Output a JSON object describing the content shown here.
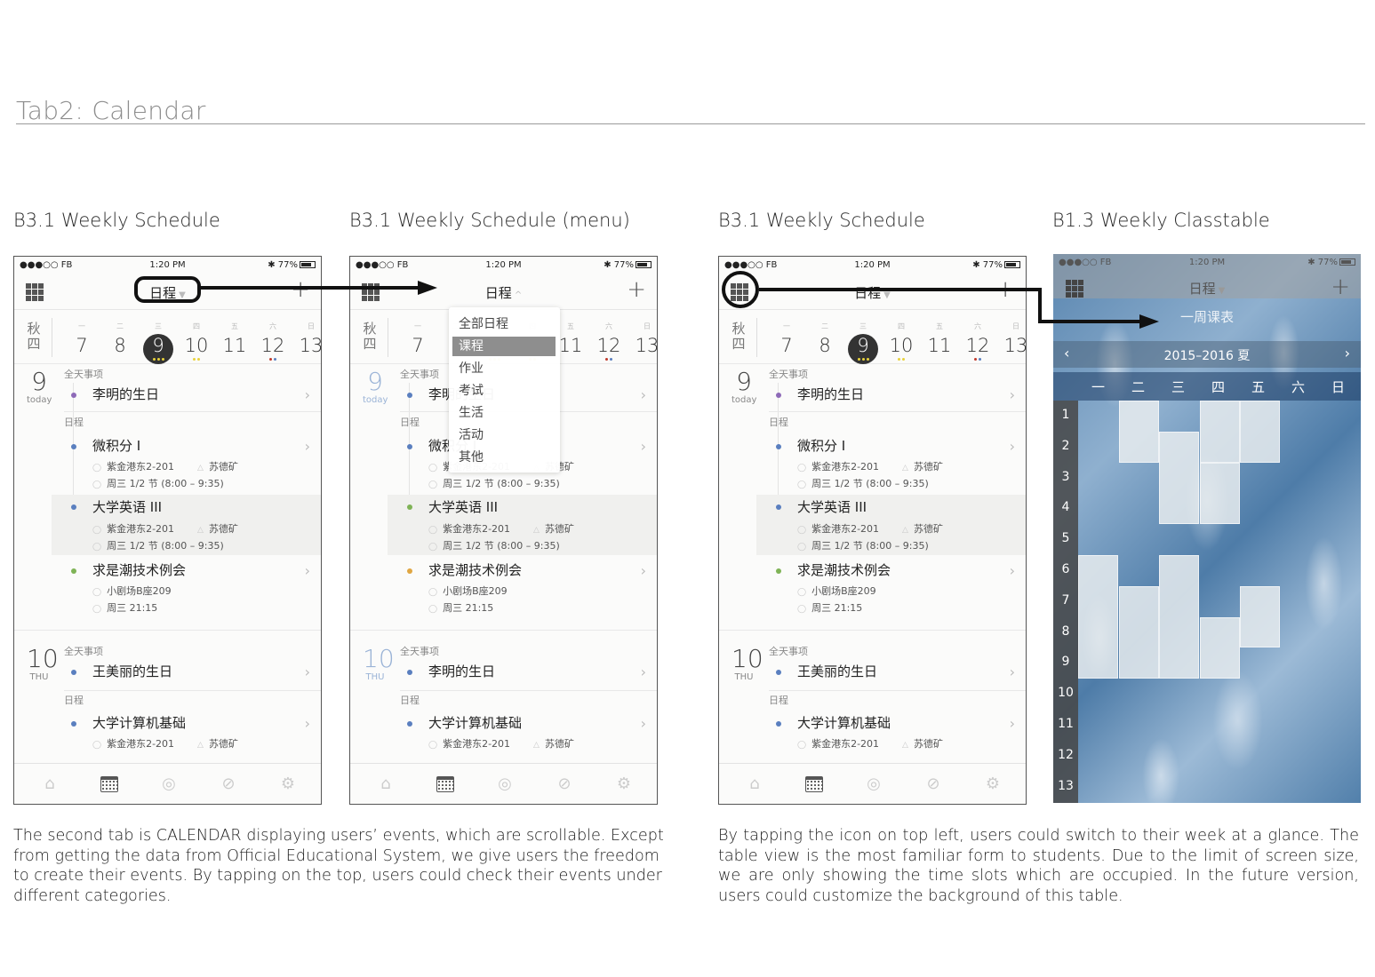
{
  "page_title": "Tab2: Calendar",
  "labels": {
    "s1": "B3.1 Weekly Schedule",
    "s2": "B3.1 Weekly Schedule (menu)",
    "s3": "B3.1 Weekly Schedule",
    "s4": "B1.3 Weekly Classtable"
  },
  "statusbar": {
    "carrier": "●●●○○ FB",
    "time": "1:20 PM",
    "battery": "77%"
  },
  "nav": {
    "title": "日程",
    "title_caret_down": "▼",
    "title_caret_up": "^",
    "add": "+"
  },
  "week": {
    "semester_top": "秋",
    "semester_bottom": "四",
    "days": [
      {
        "wd": "一",
        "n": "7"
      },
      {
        "wd": "二",
        "n": "8"
      },
      {
        "wd": "三",
        "n": "9"
      },
      {
        "wd": "四",
        "n": "10"
      },
      {
        "wd": "五",
        "n": "11"
      },
      {
        "wd": "六",
        "n": "12"
      },
      {
        "wd": "日",
        "n": "13"
      }
    ]
  },
  "list": {
    "day1_num": "9",
    "day1_sub": "today",
    "allday_label": "全天事项",
    "schedule_label": "日程",
    "birthday1": "李明的生日",
    "ev1_title": "微积分 I",
    "ev1_place": "紫金港东2-201",
    "ev1_teacher": "苏德矿",
    "ev1_time": "周三 1/2 节 (8:00 – 9:35)",
    "ev2_title": "大学英语 III",
    "ev2_place": "紫金港东2-201",
    "ev2_teacher": "苏德矿",
    "ev2_time": "周三 1/2 节 (8:00 – 9:35)",
    "ev3_title": "求是潮技术例会",
    "ev3_place": "小剧场B座209",
    "ev3_time": "周三 21:15",
    "day2_num": "10",
    "day2_sub": "THU",
    "birthday2": "王美丽的生日",
    "birthday2_menu": "李明的生日",
    "ev4_title": "大学计算机基础",
    "ev4_place": "紫金港东2-201",
    "ev4_teacher": "苏德矿"
  },
  "menu_items": [
    "全部日程",
    "课程",
    "作业",
    "考试",
    "生活",
    "活动",
    "其他"
  ],
  "menu_selected": "课程",
  "classtable": {
    "title": "一周课表",
    "term": "2015–2016 夏",
    "days": [
      "一",
      "二",
      "三",
      "四",
      "五",
      "六",
      "日"
    ],
    "periods": [
      "1",
      "2",
      "3",
      "4",
      "5",
      "6",
      "7",
      "8",
      "9",
      "10",
      "11",
      "12",
      "13"
    ]
  },
  "paragraphs": {
    "left": "The second tab is CALENDAR displaying users’ events, which are scrollable. Except from getting the data from Official Educational System, we give users the freedom to create their events. By tapping on the top, users could check their events under different categories.",
    "right": "By tapping the icon on top left, users could switch to their week at a glance. The table view is the most familiar form to students. Due to the limit of screen size, we are only showing the time slots which are occupied. In the future version, users could customize the background of this table."
  },
  "colors": {
    "dot_purple": "#8e6ab8",
    "dot_blue": "#5a7fbf",
    "dot_green": "#7fb356",
    "dot_orange": "#e0a642",
    "dot_yellow": "#e8d23c",
    "dot_red": "#c0392b"
  }
}
